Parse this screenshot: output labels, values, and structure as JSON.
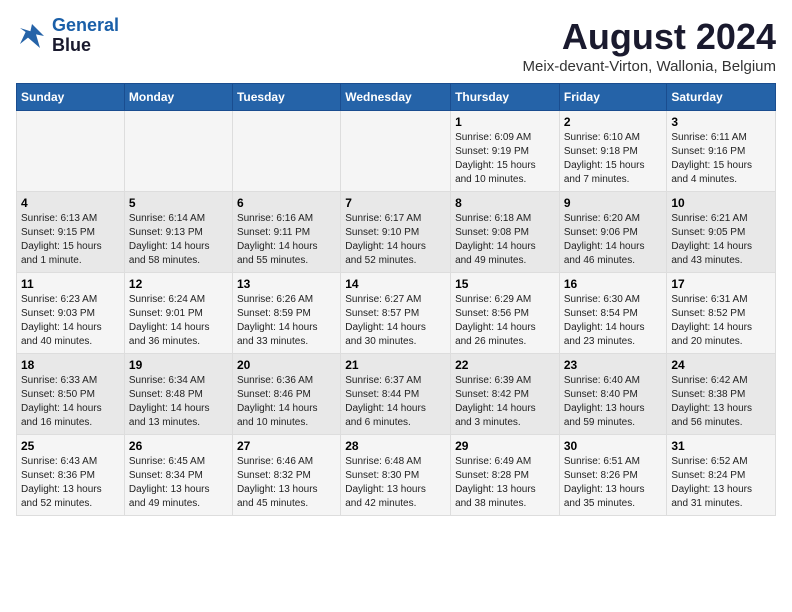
{
  "header": {
    "logo_line1": "General",
    "logo_line2": "Blue",
    "month_title": "August 2024",
    "subtitle": "Meix-devant-Virton, Wallonia, Belgium"
  },
  "weekdays": [
    "Sunday",
    "Monday",
    "Tuesday",
    "Wednesday",
    "Thursday",
    "Friday",
    "Saturday"
  ],
  "weeks": [
    [
      {
        "day": "",
        "info": ""
      },
      {
        "day": "",
        "info": ""
      },
      {
        "day": "",
        "info": ""
      },
      {
        "day": "",
        "info": ""
      },
      {
        "day": "1",
        "info": "Sunrise: 6:09 AM\nSunset: 9:19 PM\nDaylight: 15 hours\nand 10 minutes."
      },
      {
        "day": "2",
        "info": "Sunrise: 6:10 AM\nSunset: 9:18 PM\nDaylight: 15 hours\nand 7 minutes."
      },
      {
        "day": "3",
        "info": "Sunrise: 6:11 AM\nSunset: 9:16 PM\nDaylight: 15 hours\nand 4 minutes."
      }
    ],
    [
      {
        "day": "4",
        "info": "Sunrise: 6:13 AM\nSunset: 9:15 PM\nDaylight: 15 hours\nand 1 minute."
      },
      {
        "day": "5",
        "info": "Sunrise: 6:14 AM\nSunset: 9:13 PM\nDaylight: 14 hours\nand 58 minutes."
      },
      {
        "day": "6",
        "info": "Sunrise: 6:16 AM\nSunset: 9:11 PM\nDaylight: 14 hours\nand 55 minutes."
      },
      {
        "day": "7",
        "info": "Sunrise: 6:17 AM\nSunset: 9:10 PM\nDaylight: 14 hours\nand 52 minutes."
      },
      {
        "day": "8",
        "info": "Sunrise: 6:18 AM\nSunset: 9:08 PM\nDaylight: 14 hours\nand 49 minutes."
      },
      {
        "day": "9",
        "info": "Sunrise: 6:20 AM\nSunset: 9:06 PM\nDaylight: 14 hours\nand 46 minutes."
      },
      {
        "day": "10",
        "info": "Sunrise: 6:21 AM\nSunset: 9:05 PM\nDaylight: 14 hours\nand 43 minutes."
      }
    ],
    [
      {
        "day": "11",
        "info": "Sunrise: 6:23 AM\nSunset: 9:03 PM\nDaylight: 14 hours\nand 40 minutes."
      },
      {
        "day": "12",
        "info": "Sunrise: 6:24 AM\nSunset: 9:01 PM\nDaylight: 14 hours\nand 36 minutes."
      },
      {
        "day": "13",
        "info": "Sunrise: 6:26 AM\nSunset: 8:59 PM\nDaylight: 14 hours\nand 33 minutes."
      },
      {
        "day": "14",
        "info": "Sunrise: 6:27 AM\nSunset: 8:57 PM\nDaylight: 14 hours\nand 30 minutes."
      },
      {
        "day": "15",
        "info": "Sunrise: 6:29 AM\nSunset: 8:56 PM\nDaylight: 14 hours\nand 26 minutes."
      },
      {
        "day": "16",
        "info": "Sunrise: 6:30 AM\nSunset: 8:54 PM\nDaylight: 14 hours\nand 23 minutes."
      },
      {
        "day": "17",
        "info": "Sunrise: 6:31 AM\nSunset: 8:52 PM\nDaylight: 14 hours\nand 20 minutes."
      }
    ],
    [
      {
        "day": "18",
        "info": "Sunrise: 6:33 AM\nSunset: 8:50 PM\nDaylight: 14 hours\nand 16 minutes."
      },
      {
        "day": "19",
        "info": "Sunrise: 6:34 AM\nSunset: 8:48 PM\nDaylight: 14 hours\nand 13 minutes."
      },
      {
        "day": "20",
        "info": "Sunrise: 6:36 AM\nSunset: 8:46 PM\nDaylight: 14 hours\nand 10 minutes."
      },
      {
        "day": "21",
        "info": "Sunrise: 6:37 AM\nSunset: 8:44 PM\nDaylight: 14 hours\nand 6 minutes."
      },
      {
        "day": "22",
        "info": "Sunrise: 6:39 AM\nSunset: 8:42 PM\nDaylight: 14 hours\nand 3 minutes."
      },
      {
        "day": "23",
        "info": "Sunrise: 6:40 AM\nSunset: 8:40 PM\nDaylight: 13 hours\nand 59 minutes."
      },
      {
        "day": "24",
        "info": "Sunrise: 6:42 AM\nSunset: 8:38 PM\nDaylight: 13 hours\nand 56 minutes."
      }
    ],
    [
      {
        "day": "25",
        "info": "Sunrise: 6:43 AM\nSunset: 8:36 PM\nDaylight: 13 hours\nand 52 minutes."
      },
      {
        "day": "26",
        "info": "Sunrise: 6:45 AM\nSunset: 8:34 PM\nDaylight: 13 hours\nand 49 minutes."
      },
      {
        "day": "27",
        "info": "Sunrise: 6:46 AM\nSunset: 8:32 PM\nDaylight: 13 hours\nand 45 minutes."
      },
      {
        "day": "28",
        "info": "Sunrise: 6:48 AM\nSunset: 8:30 PM\nDaylight: 13 hours\nand 42 minutes."
      },
      {
        "day": "29",
        "info": "Sunrise: 6:49 AM\nSunset: 8:28 PM\nDaylight: 13 hours\nand 38 minutes."
      },
      {
        "day": "30",
        "info": "Sunrise: 6:51 AM\nSunset: 8:26 PM\nDaylight: 13 hours\nand 35 minutes."
      },
      {
        "day": "31",
        "info": "Sunrise: 6:52 AM\nSunset: 8:24 PM\nDaylight: 13 hours\nand 31 minutes."
      }
    ]
  ]
}
